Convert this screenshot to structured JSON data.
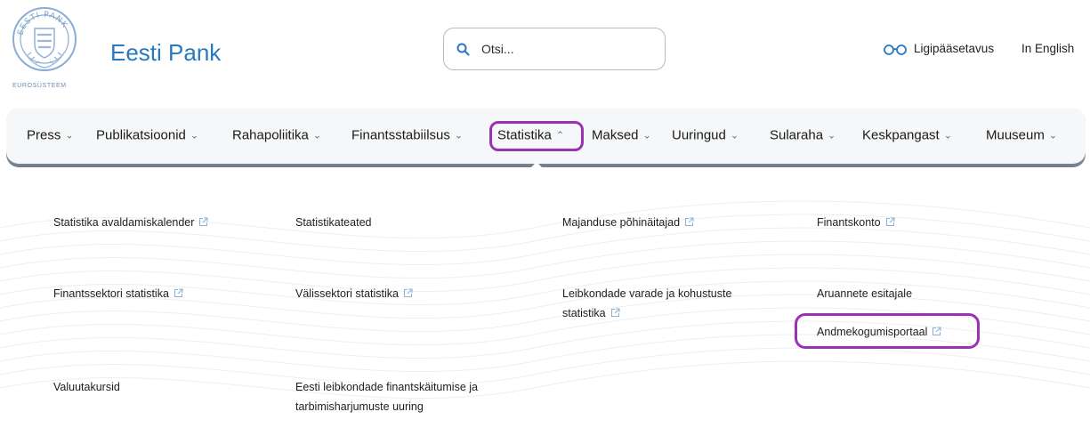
{
  "header": {
    "seal_text": "EESTI PANK",
    "logo_caption": "EUROSÜSTEEM",
    "brand": "Eesti Pank",
    "search_placeholder": "Otsi...",
    "accessibility_label": "Ligipääsetavus",
    "language_label": "In English"
  },
  "nav": {
    "items": [
      {
        "label": "Press",
        "chevron": "⌄"
      },
      {
        "label": "Publikatsioonid",
        "chevron": "⌄"
      },
      {
        "label": "Rahapoliitika",
        "chevron": "⌄"
      },
      {
        "label": "Finantsstabiilsus",
        "chevron": "⌄"
      },
      {
        "label": "Statistika",
        "chevron": "⌃"
      },
      {
        "label": "Maksed",
        "chevron": "⌄"
      },
      {
        "label": "Uuringud",
        "chevron": "⌄"
      },
      {
        "label": "Sularaha",
        "chevron": "⌄"
      },
      {
        "label": "Keskpangast",
        "chevron": "⌄"
      },
      {
        "label": "Muuseum",
        "chevron": "⌄"
      }
    ],
    "active": "Statistika"
  },
  "menu": {
    "col1": [
      {
        "label": "Statistika avaldamiskalender",
        "external": true
      },
      {
        "label": "Finantssektori statistika",
        "external": true
      },
      {
        "label": "Valuutakursid",
        "external": false
      }
    ],
    "col2": [
      {
        "label": "Statistikateated",
        "external": false
      },
      {
        "label": "Välissektori statistika",
        "external": true
      },
      {
        "label_line1": "Eesti leibkondade finantskäitumise ja",
        "label_line2": "tarbimisharjumuste uuring",
        "external": false
      }
    ],
    "col3": [
      {
        "label": "Majanduse põhinäitajad",
        "external": true
      },
      {
        "label_line1": "Leibkondade varade ja kohustuste",
        "label_line2": "statistika",
        "external": true
      }
    ],
    "col4": [
      {
        "label": "Finantskonto",
        "external": true
      },
      {
        "label": "Aruannete esitajale",
        "external": false
      },
      {
        "label": "Andmekogumisportaal",
        "external": true
      }
    ]
  },
  "colors": {
    "brand_blue": "#2a78c0",
    "highlight_purple": "#9b32b4",
    "external_icon": "#8fb2d9"
  }
}
